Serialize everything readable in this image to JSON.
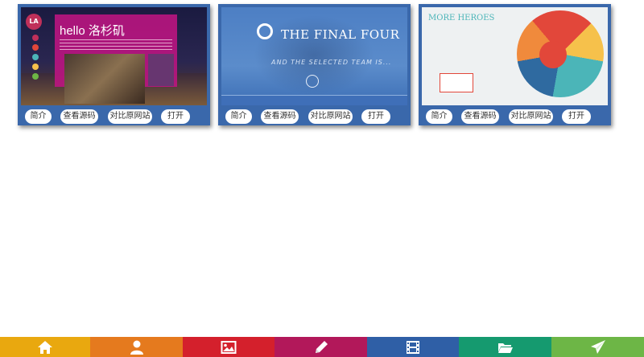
{
  "cards": [
    {
      "buttons": [
        "简介",
        "查看源码",
        "对比原网站",
        "打开"
      ],
      "thumb": {
        "logo": "LA",
        "hello": "hello 洛杉矶"
      }
    },
    {
      "buttons": [
        "简介",
        "查看源码",
        "对比原网站",
        "打开"
      ],
      "thumb": {
        "title": "THE FINAL FOUR",
        "sub": "AND THE SELECTED TEAM IS..."
      }
    },
    {
      "buttons": [
        "简介",
        "查看源码",
        "对比原网站",
        "打开"
      ],
      "thumb": {
        "words": "MORE HEROES"
      }
    }
  ],
  "bottombar": [
    {
      "icon": "home-icon",
      "color": "#e9a80f"
    },
    {
      "icon": "user-icon",
      "color": "#e57a1e"
    },
    {
      "icon": "image-icon",
      "color": "#d4202c"
    },
    {
      "icon": "pencil-icon",
      "color": "#b2185a"
    },
    {
      "icon": "film-icon",
      "color": "#2f5fa6"
    },
    {
      "icon": "folder-icon",
      "color": "#159a6f"
    },
    {
      "icon": "send-icon",
      "color": "#6db646"
    }
  ]
}
